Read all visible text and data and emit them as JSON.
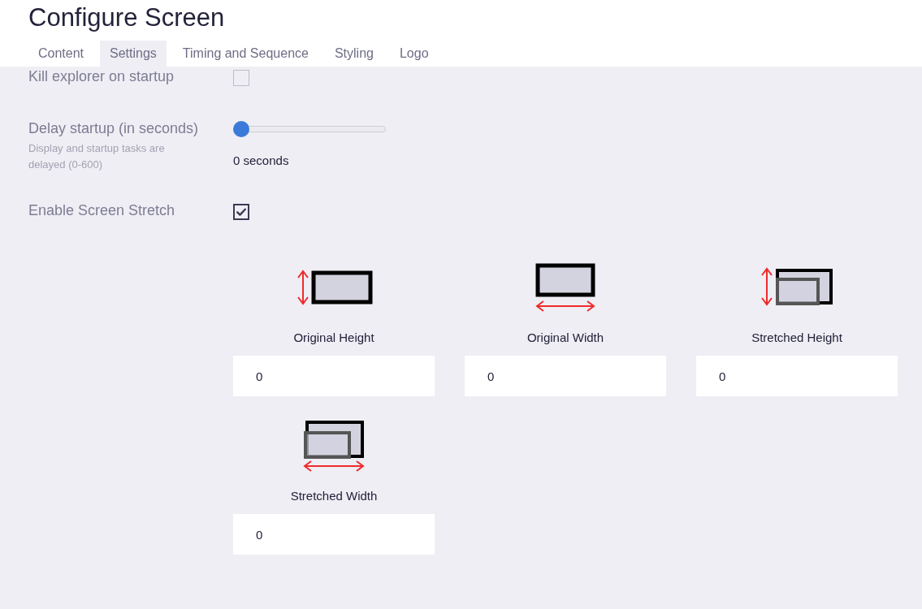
{
  "title": "Configure Screen",
  "tabs": [
    {
      "label": "Content",
      "selected": false
    },
    {
      "label": "Settings",
      "selected": true
    },
    {
      "label": "Timing and Sequence",
      "selected": false
    },
    {
      "label": "Styling",
      "selected": false
    },
    {
      "label": "Logo",
      "selected": false
    }
  ],
  "settings": [
    {
      "kind": "checkbox",
      "label": "Kill explorer on startup",
      "checked": false
    },
    {
      "kind": "slider",
      "label": "Delay startup (in seconds)",
      "hint": "Display and startup tasks are delayed (0-600)",
      "level": 0,
      "reading": "0 seconds"
    },
    {
      "kind": "checkbox",
      "label": "Enable Screen Stretch",
      "checked": true
    }
  ],
  "stretch_fields": [
    {
      "kind": "original-height",
      "label": "Original Height",
      "value": "0"
    },
    {
      "kind": "original-width",
      "label": "Original Width",
      "value": "0"
    },
    {
      "kind": "stretched-height",
      "label": "Stretched Height",
      "value": "0"
    },
    {
      "kind": "stretched-width",
      "label": "Stretched Width",
      "value": "0"
    }
  ]
}
